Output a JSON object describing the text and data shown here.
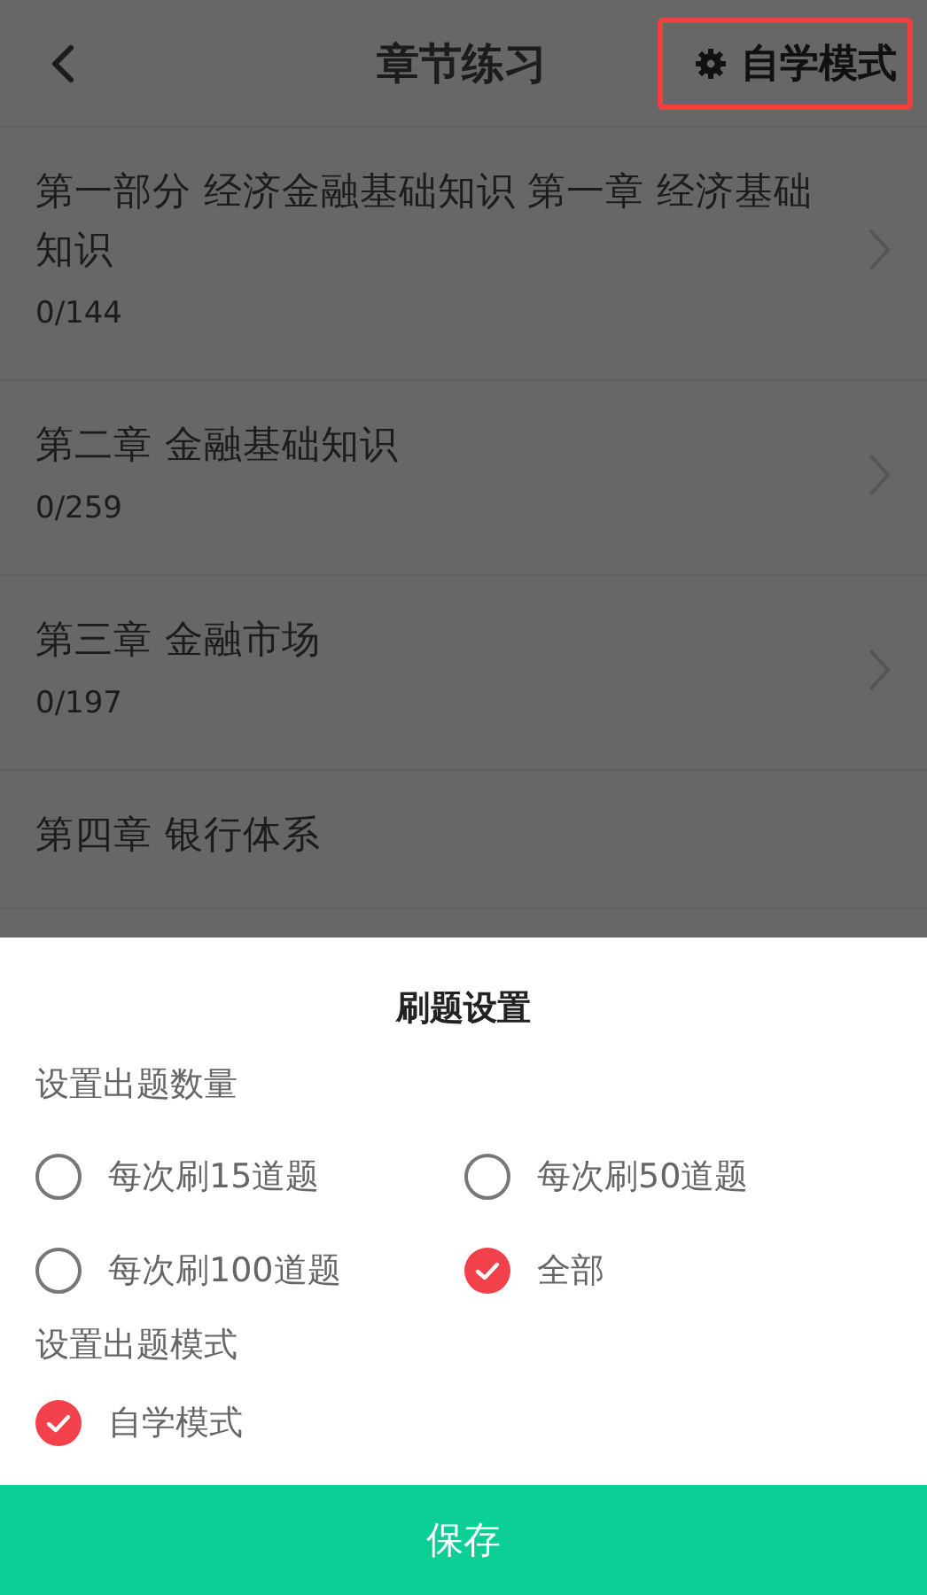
{
  "header": {
    "title": "章节练习",
    "mode_button": {
      "label": "自学模式",
      "highlighted": true
    }
  },
  "chapters": [
    {
      "title": "第一部分 经济金融基础知识 第一章 经济基础知识",
      "progress": "0/144"
    },
    {
      "title": "第二章 金融基础知识",
      "progress": "0/259"
    },
    {
      "title": "第三章 金融市场",
      "progress": "0/197"
    },
    {
      "title": "第四章 银行体系"
    }
  ],
  "sheet": {
    "title": "刷题设置",
    "sections": [
      {
        "label": "设置出题数量",
        "options": [
          {
            "label": "每次刷15道题",
            "selected": false
          },
          {
            "label": "每次刷50道题",
            "selected": false
          },
          {
            "label": "每次刷100道题",
            "selected": false
          },
          {
            "label": "全部",
            "selected": true
          }
        ]
      },
      {
        "label": "设置出题模式",
        "options": [
          {
            "label": "自学模式",
            "selected": true
          }
        ]
      }
    ],
    "save_button": "保存"
  }
}
